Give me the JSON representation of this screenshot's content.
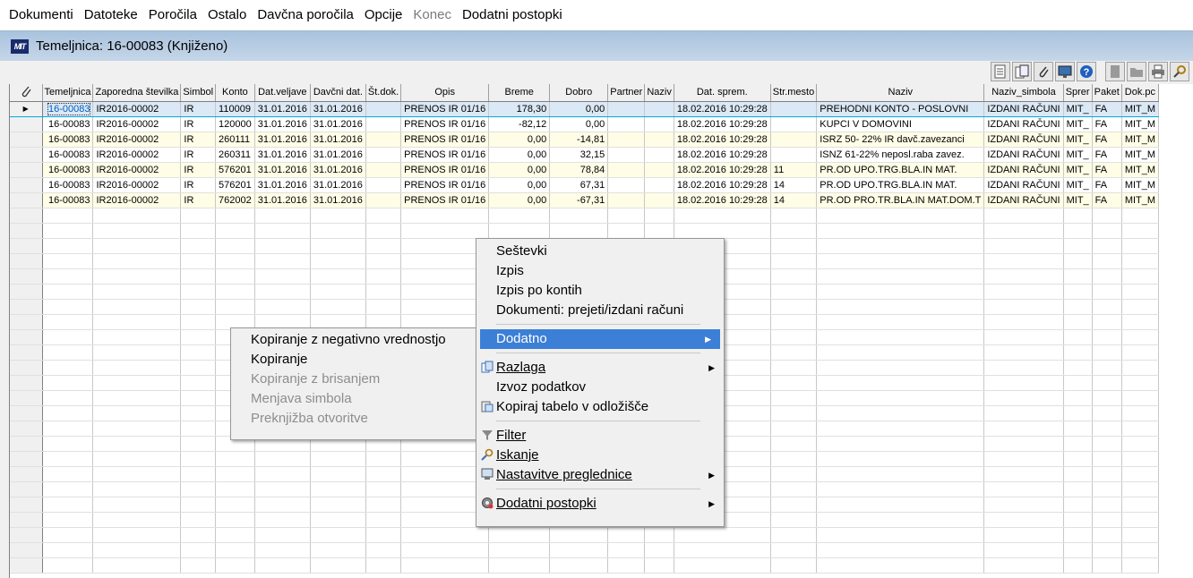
{
  "menubar": {
    "items": [
      {
        "label": "Dokumenti",
        "disabled": false
      },
      {
        "label": "Datoteke",
        "disabled": false
      },
      {
        "label": "Poročila",
        "disabled": false
      },
      {
        "label": "Ostalo",
        "disabled": false
      },
      {
        "label": "Davčna poročila",
        "disabled": false
      },
      {
        "label": "Opcije",
        "disabled": false
      },
      {
        "label": "Konec",
        "disabled": true
      },
      {
        "label": "Dodatni postopki",
        "disabled": false
      }
    ]
  },
  "window": {
    "logo": "MIT",
    "title": "Temeljnica: 16-00083  (Knjiženo)"
  },
  "toolbar": {
    "icons": [
      "document-icon",
      "report-icon",
      "attachment-icon",
      "monitor-icon",
      "help-icon",
      "blank-doc-icon",
      "open-folder-icon",
      "print-icon",
      "search-icon"
    ]
  },
  "table": {
    "columns": [
      "",
      "Temeljnica",
      "Zaporedna številka",
      "Simbol",
      "Konto",
      "Dat.veljave",
      "Davčni dat.",
      "Št.dok.",
      "Opis",
      "Breme",
      "Dobro",
      "Partner",
      "Naziv",
      "Dat. sprem.",
      "Str.mesto",
      "Naziv",
      "Naziv_simbola",
      "Sprer",
      "Paket",
      "Dok.pc"
    ],
    "rows": [
      [
        "16-00083",
        "IR2016-00002",
        "IR",
        "110009",
        "31.01.2016",
        "31.01.2016",
        "",
        "PRENOS IR 01/16",
        "178,30",
        "0,00",
        "",
        "",
        "18.02.2016 10:29:28",
        "",
        "PREHODNI KONTO - POSLOVNI",
        "IZDANI RAČUNI",
        "MIT_",
        "FA",
        "MIT_M"
      ],
      [
        "16-00083",
        "IR2016-00002",
        "IR",
        "120000",
        "31.01.2016",
        "31.01.2016",
        "",
        "PRENOS IR 01/16",
        "-82,12",
        "0,00",
        "",
        "",
        "18.02.2016 10:29:28",
        "",
        "KUPCI V DOMOVINI",
        "IZDANI RAČUNI",
        "MIT_",
        "FA",
        "MIT_M"
      ],
      [
        "16-00083",
        "IR2016-00002",
        "IR",
        "260111",
        "31.01.2016",
        "31.01.2016",
        "",
        "PRENOS IR 01/16",
        "0,00",
        "-14,81",
        "",
        "",
        "18.02.2016 10:29:28",
        "",
        "ISRZ 50- 22% IR davč.zavezanci",
        "IZDANI RAČUNI",
        "MIT_",
        "FA",
        "MIT_M"
      ],
      [
        "16-00083",
        "IR2016-00002",
        "IR",
        "260311",
        "31.01.2016",
        "31.01.2016",
        "",
        "PRENOS IR 01/16",
        "0,00",
        "32,15",
        "",
        "",
        "18.02.2016 10:29:28",
        "",
        "ISNZ 61-22% neposl.raba zavez.",
        "IZDANI RAČUNI",
        "MIT_",
        "FA",
        "MIT_M"
      ],
      [
        "16-00083",
        "IR2016-00002",
        "IR",
        "576201",
        "31.01.2016",
        "31.01.2016",
        "",
        "PRENOS IR 01/16",
        "0,00",
        "78,84",
        "",
        "",
        "18.02.2016 10:29:28",
        "11",
        "PR.OD UPO.TRG.BLA.IN MAT.",
        "IZDANI RAČUNI",
        "MIT_",
        "FA",
        "MIT_M"
      ],
      [
        "16-00083",
        "IR2016-00002",
        "IR",
        "576201",
        "31.01.2016",
        "31.01.2016",
        "",
        "PRENOS IR 01/16",
        "0,00",
        "67,31",
        "",
        "",
        "18.02.2016 10:29:28",
        "14",
        "PR.OD UPO.TRG.BLA.IN MAT.",
        "IZDANI RAČUNI",
        "MIT_",
        "FA",
        "MIT_M"
      ],
      [
        "16-00083",
        "IR2016-00002",
        "IR",
        "762002",
        "31.01.2016",
        "31.01.2016",
        "",
        "PRENOS IR 01/16",
        "0,00",
        "-67,31",
        "",
        "",
        "18.02.2016 10:29:28",
        "14",
        "PR.OD PRO.TR.BLA.IN MAT.DOM.T",
        "IZDANI RAČUNI",
        "MIT_",
        "FA",
        "MIT_M"
      ]
    ]
  },
  "context_menu": {
    "items": [
      {
        "label": "Seštevki"
      },
      {
        "label": "Izpis"
      },
      {
        "label": "Izpis po kontih"
      },
      {
        "label": "Dokumenti: prejeti/izdani računi"
      },
      {
        "label": "Dodatno"
      },
      {
        "label": "Razlaga"
      },
      {
        "label": "Izvoz podatkov"
      },
      {
        "label": "Kopiraj tabelo v odložišče"
      },
      {
        "label": "Filter"
      },
      {
        "label": "Iskanje"
      },
      {
        "label": "Nastavitve preglednice"
      },
      {
        "label": "Dodatni postopki"
      }
    ]
  },
  "submenu": {
    "items": [
      {
        "label": "Kopiranje z negativno vrednostjo",
        "disabled": false
      },
      {
        "label": "Kopiranje",
        "disabled": false
      },
      {
        "label": "Kopiranje z brisanjem",
        "disabled": true
      },
      {
        "label": "Menjava simbola",
        "disabled": true
      },
      {
        "label": "Preknjižba otvoritve",
        "disabled": true
      }
    ]
  }
}
